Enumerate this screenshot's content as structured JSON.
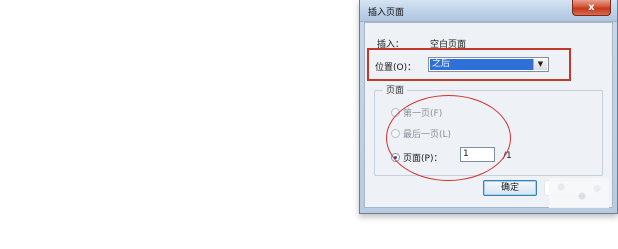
{
  "window": {
    "title": "插入页面",
    "close_symbol": "x"
  },
  "form": {
    "insert_label": "插入：",
    "insert_value": "空白页面",
    "position_label": "位置(O)：",
    "position_value": "之后",
    "dropdown_arrow": "▼"
  },
  "pages_group": {
    "title": "页面",
    "options": [
      {
        "label": "第一页(F)",
        "checked": false,
        "enabled": false
      },
      {
        "label": "最后一页(L)",
        "checked": false,
        "enabled": false
      },
      {
        "label": "页面(P)：",
        "checked": true,
        "enabled": true
      }
    ],
    "page_number_value": "1",
    "page_total": "/1"
  },
  "buttons": {
    "ok_label": "确定"
  },
  "colors": {
    "selection_blue": "#2f6fd8",
    "annotation_red": "#c0392b",
    "close_red": "#c23a1e"
  }
}
